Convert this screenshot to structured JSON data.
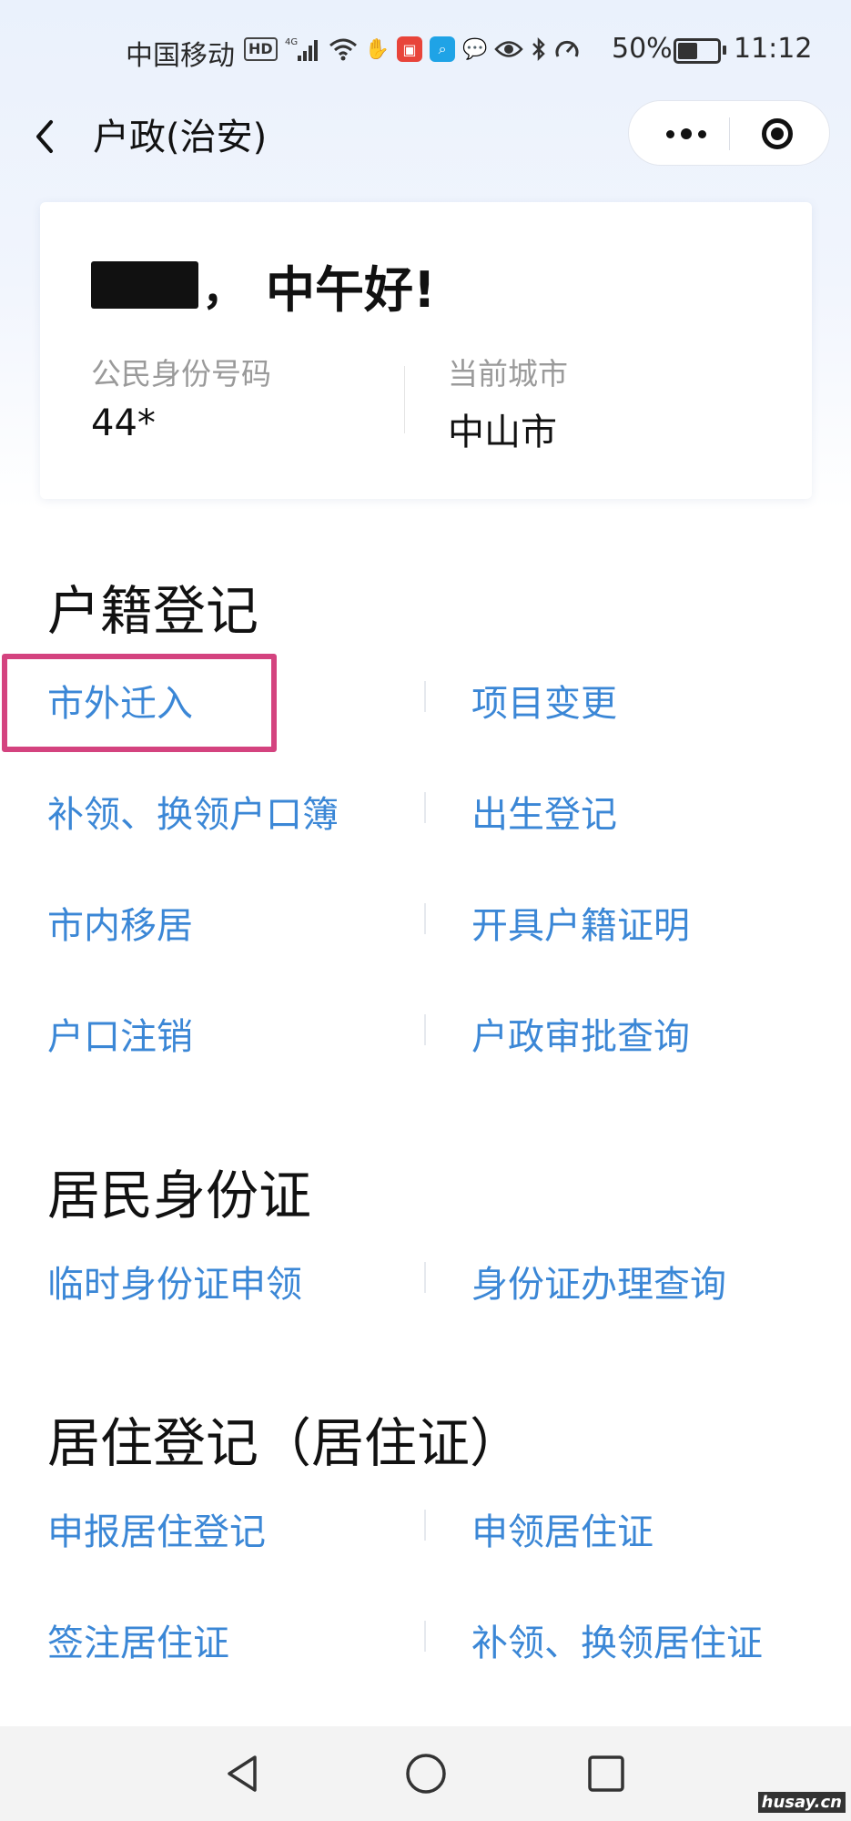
{
  "status_bar": {
    "carrier": "中国移动",
    "hd": "HD",
    "network": "4G",
    "battery_pct": "50%",
    "battery_level": 0.5,
    "time": "11:12",
    "icons": [
      "hd-icon",
      "signal-icon",
      "wifi-icon",
      "hand-icon",
      "book-app-icon",
      "search-app-icon",
      "chat-icon",
      "eye-icon",
      "bluetooth-icon",
      "speed-icon",
      "battery-icon"
    ]
  },
  "nav": {
    "title": "户政(治安)"
  },
  "user_card": {
    "greeting": "中午好!",
    "comma": "，",
    "id_label": "公民身份号码",
    "id_value": "44*",
    "city_label": "当前城市",
    "city_value": "中山市"
  },
  "sections": [
    {
      "title": "户籍登记",
      "items": [
        "市外迁入",
        "项目变更",
        "补领、换领户口簿",
        "出生登记",
        "市内移居",
        "开具户籍证明",
        "户口注销",
        "户政审批查询"
      ]
    },
    {
      "title": "居民身份证",
      "items": [
        "临时身份证申领",
        "身份证办理查询"
      ]
    },
    {
      "title": "居住登记（居住证）",
      "items": [
        "申报居住登记",
        "申领居住证",
        "签注居住证",
        "补领、换领居住证"
      ]
    }
  ],
  "highlight_color": "#d4437f",
  "link_color": "#3b87d6",
  "watermark": "husay.cn"
}
